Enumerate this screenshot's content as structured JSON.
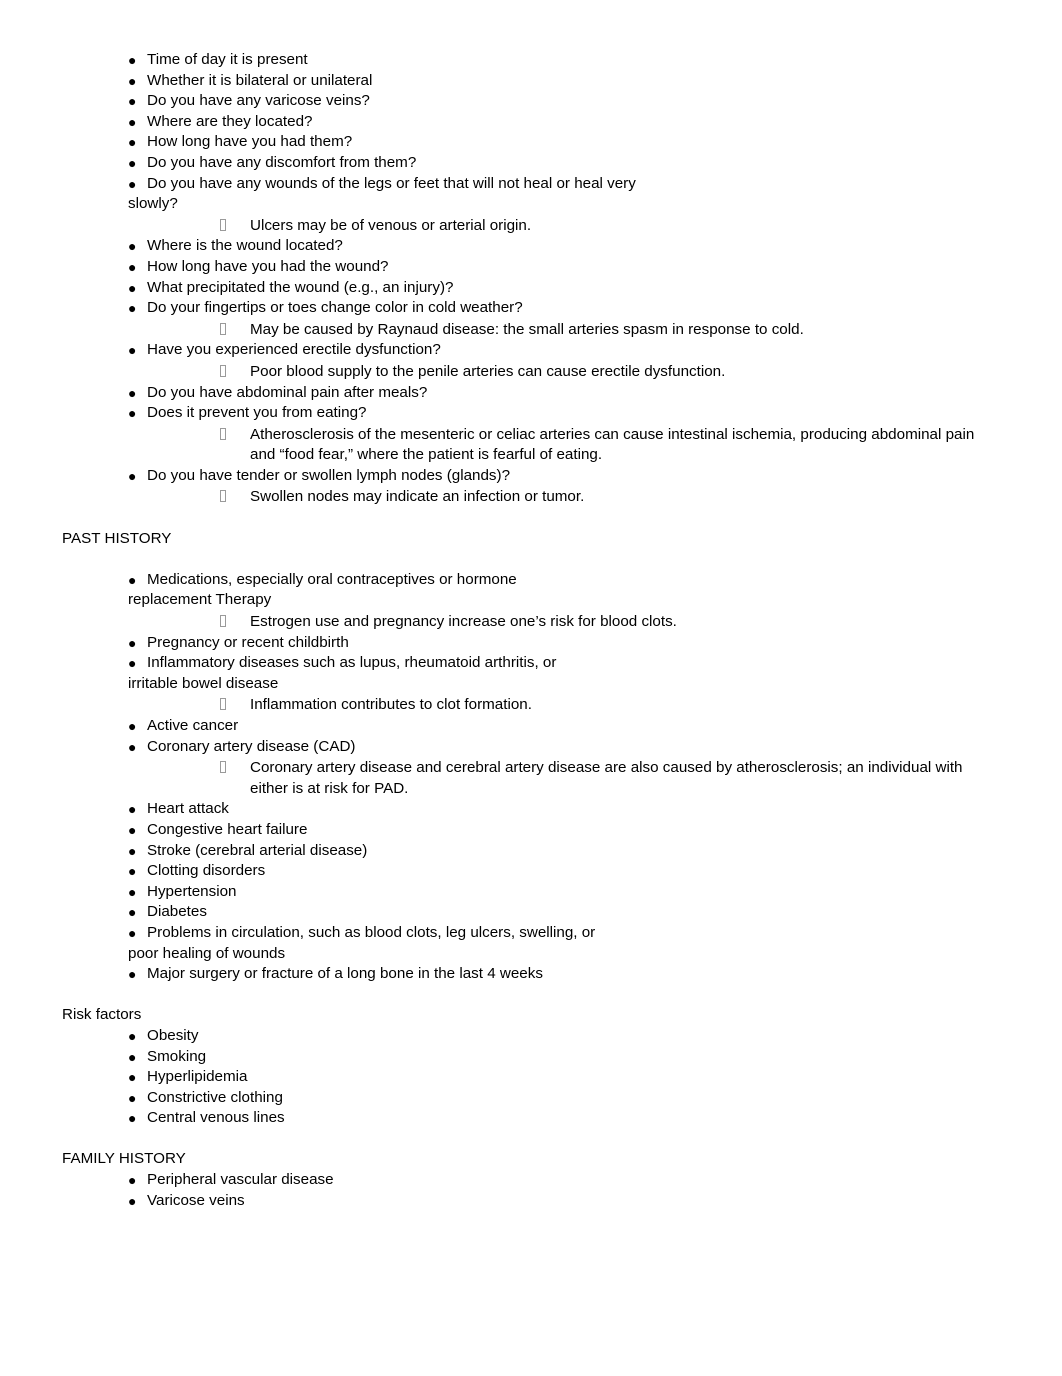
{
  "document": {
    "sections": [
      {
        "id": "symptoms-continued",
        "heading": null,
        "items": [
          {
            "type": "bullet",
            "text": "Time of day it is present"
          },
          {
            "type": "bullet",
            "text": "Whether it is bilateral or unilateral"
          },
          {
            "type": "bullet",
            "text": "Do you have any varicose veins?"
          },
          {
            "type": "bullet",
            "text": "Where are they located?"
          },
          {
            "type": "bullet",
            "text": "How long have you had them?"
          },
          {
            "type": "bullet",
            "text": "Do you have any discomfort from them?"
          },
          {
            "type": "bullet",
            "text": "Do you have any wounds of the legs or feet that will not heal or heal very",
            "continuation": "slowly?"
          },
          {
            "type": "sub",
            "text": "Ulcers may be of venous or arterial origin."
          },
          {
            "type": "bullet",
            "text": "Where is the wound located?"
          },
          {
            "type": "bullet",
            "text": "How long have you had the wound?"
          },
          {
            "type": "bullet",
            "text": "What precipitated the wound (e.g., an injury)?"
          },
          {
            "type": "bullet",
            "text": "Do your fingertips or toes change color in cold weather?"
          },
          {
            "type": "sub",
            "text": "May be caused by Raynaud disease: the small arteries spasm in response to cold."
          },
          {
            "type": "bullet",
            "text": "Have you experienced erectile dysfunction?"
          },
          {
            "type": "sub",
            "text": "Poor blood supply to the penile arteries can cause erectile dysfunction."
          },
          {
            "type": "bullet",
            "text": "Do you have abdominal pain after meals?"
          },
          {
            "type": "bullet",
            "text": "Does it prevent you from eating?"
          },
          {
            "type": "sub",
            "text": "Atherosclerosis of the mesenteric or celiac arteries can cause intestinal ischemia, producing abdominal pain and “food fear,” where the patient is fearful of eating."
          },
          {
            "type": "bullet",
            "text": "Do you have tender or swollen lymph nodes (glands)?"
          },
          {
            "type": "sub",
            "text": "Swollen nodes may indicate an infection or tumor."
          }
        ]
      },
      {
        "id": "past-history",
        "heading": "PAST HISTORY",
        "items": [
          {
            "type": "bullet",
            "text": "Medications, especially oral contraceptives or hormone",
            "continuation": "replacement Therapy"
          },
          {
            "type": "sub",
            "text": "Estrogen use and pregnancy increase one’s risk for blood clots."
          },
          {
            "type": "bullet",
            "text": "Pregnancy or recent childbirth"
          },
          {
            "type": "bullet",
            "text": "Inflammatory diseases such as lupus, rheumatoid arthritis, or",
            "continuation": "irritable bowel disease"
          },
          {
            "type": "sub",
            "text": "Inflammation contributes to clot formation."
          },
          {
            "type": "bullet",
            "text": "Active cancer"
          },
          {
            "type": "bullet",
            "text": "Coronary artery disease (CAD)"
          },
          {
            "type": "sub",
            "text": "Coronary artery disease and cerebral artery disease are also caused by atherosclerosis; an individual with either is at risk for PAD."
          },
          {
            "type": "bullet",
            "text": "Heart attack"
          },
          {
            "type": "bullet",
            "text": "Congestive heart failure"
          },
          {
            "type": "bullet",
            "text": "Stroke (cerebral arterial disease)"
          },
          {
            "type": "bullet",
            "text": "Clotting disorders"
          },
          {
            "type": "bullet",
            "text": "Hypertension"
          },
          {
            "type": "bullet",
            "text": "Diabetes"
          },
          {
            "type": "bullet",
            "text": "Problems in circulation, such as blood clots, leg ulcers, swelling, or",
            "continuation": "poor healing of wounds"
          },
          {
            "type": "bullet",
            "text": "Major surgery or fracture of a long bone in the last 4 weeks"
          }
        ]
      },
      {
        "id": "risk-factors",
        "heading": "Risk factors",
        "items": [
          {
            "type": "bullet",
            "text": "Obesity"
          },
          {
            "type": "bullet",
            "text": "Smoking"
          },
          {
            "type": "bullet",
            "text": "Hyperlipidemia"
          },
          {
            "type": "bullet",
            "text": "Constrictive clothing"
          },
          {
            "type": "bullet",
            "text": "Central venous lines"
          }
        ]
      },
      {
        "id": "family-history",
        "heading": "FAMILY HISTORY",
        "items": [
          {
            "type": "bullet",
            "text": "Peripheral vascular disease"
          },
          {
            "type": "bullet",
            "text": "Varicose veins"
          }
        ]
      }
    ],
    "glyphs": {
      "bullet_marker": "●",
      "sub_marker": "missing-glyph-box"
    },
    "colors": {
      "text": "#000000",
      "background": "#ffffff",
      "sub_marker": "#9a9a9a"
    }
  }
}
